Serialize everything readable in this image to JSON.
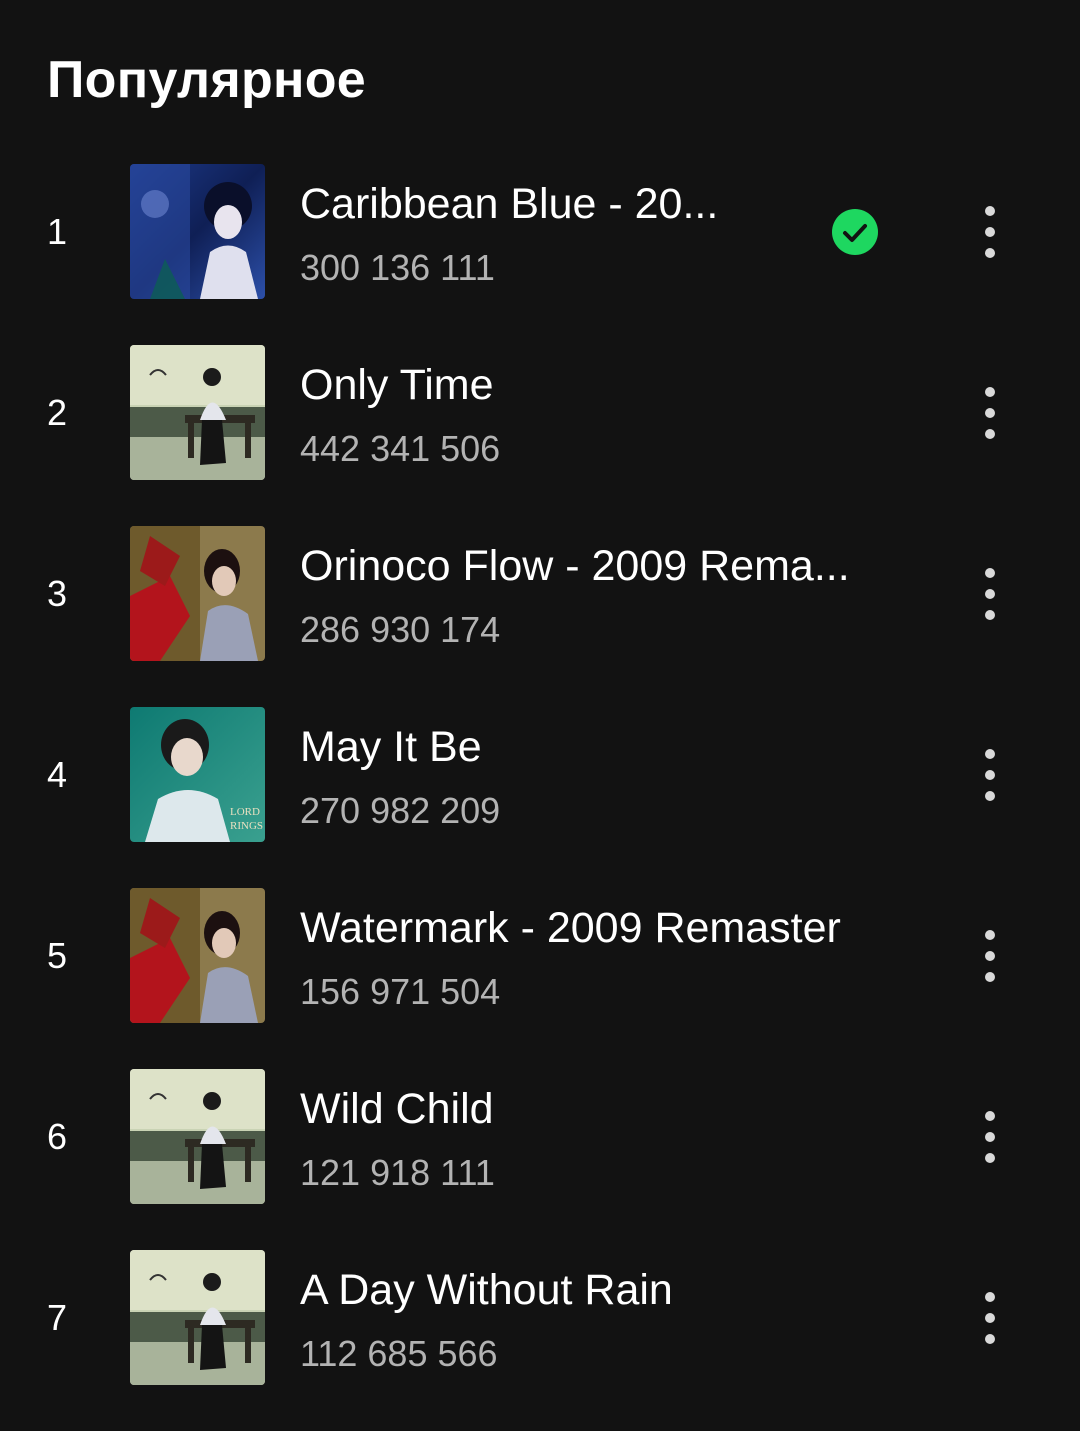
{
  "section": {
    "title": "Популярное"
  },
  "tracks": [
    {
      "rank": "1",
      "title": "Caribbean Blue - 20...",
      "plays": "300 136 111",
      "cover": "watermark-blue-cover",
      "downloaded": true
    },
    {
      "rank": "2",
      "title": "Only Time",
      "plays": "442 341 506",
      "cover": "a-day-without-rain-cover",
      "downloaded": false
    },
    {
      "rank": "3",
      "title": "Orinoco Flow - 2009 Rema...",
      "plays": "286 930 174",
      "cover": "watermark-red-cover",
      "downloaded": false
    },
    {
      "rank": "4",
      "title": "May It Be",
      "plays": "270 982 209",
      "cover": "lord-of-the-rings-cover",
      "downloaded": false
    },
    {
      "rank": "5",
      "title": "Watermark - 2009 Remaster",
      "plays": "156 971 504",
      "cover": "watermark-red-cover",
      "downloaded": false
    },
    {
      "rank": "6",
      "title": "Wild Child",
      "plays": "121 918 111",
      "cover": "a-day-without-rain-cover",
      "downloaded": false
    },
    {
      "rank": "7",
      "title": "A Day Without Rain",
      "plays": "112 685 566",
      "cover": "a-day-without-rain-cover",
      "downloaded": false
    }
  ],
  "colors": {
    "background": "#121212",
    "accent_green": "#1ed760",
    "secondary_text": "#b3b3b3"
  },
  "icons": {
    "downloaded": "checkmark-circle-icon",
    "more": "more-options-icon"
  }
}
